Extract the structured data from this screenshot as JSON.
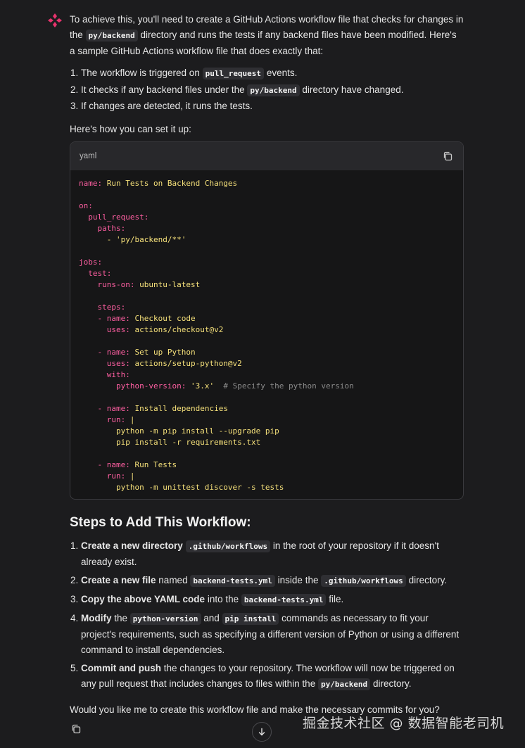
{
  "message": {
    "intro_1": "To achieve this, you'll need to create a GitHub Actions workflow file that checks for changes in the ",
    "intro_code": "py/backend",
    "intro_2": " directory and runs the tests if any backend files have been modified. Here's a sample GitHub Actions workflow file that does exactly that:",
    "list1": [
      {
        "pre": "The workflow is triggered on ",
        "code": "pull_request",
        "post": " events."
      },
      {
        "pre": "It checks if any backend files under the ",
        "code": "py/backend",
        "post": " directory have changed."
      },
      {
        "pre": "If changes are detected, it runs the tests.",
        "code": "",
        "post": ""
      }
    ],
    "setup_text": "Here's how you can set it up:",
    "code_block": {
      "language": "yaml",
      "copy_icon": "copy-icon"
    },
    "steps_heading": "Steps to Add This Workflow:",
    "steps": {
      "s1_bold": "Create a new directory",
      "s1_code": ".github/workflows",
      "s1_rest": " in the root of your repository if it doesn't already exist.",
      "s2_bold": "Create a new file",
      "s2_a": " named ",
      "s2_code1": "backend-tests.yml",
      "s2_b": " inside the ",
      "s2_code2": ".github/workflows",
      "s2_c": " directory.",
      "s3_bold": "Copy the above YAML code",
      "s3_a": " into the ",
      "s3_code": "backend-tests.yml",
      "s3_b": " file.",
      "s4_bold": "Modify",
      "s4_a": " the ",
      "s4_code1": "python-version",
      "s4_b": " and ",
      "s4_code2": "pip install",
      "s4_c": " commands as necessary to fit your project's requirements, such as specifying a different version of Python or using a different command to install dependencies.",
      "s5_bold": "Commit and push",
      "s5_a": " the changes to your repository. The workflow will now be triggered on any pull request that includes changes to files within the ",
      "s5_code": "py/backend",
      "s5_b": " directory."
    },
    "closing": "Would you like me to create this workflow file and make the necessary commits for you?"
  },
  "yaml": {
    "name_k": "name:",
    "name_v": " Run Tests on Backend Changes",
    "on_k": "on:",
    "pr_k": "  pull_request:",
    "paths_k": "    paths:",
    "path_v": "      - 'py/backend/**'",
    "jobs_k": "jobs:",
    "test_k": "  test:",
    "runs_k": "    runs-on:",
    "runs_v": " ubuntu-latest",
    "steps_k": "    steps:",
    "s1_dash": "    - ",
    "s1_name_k": "name:",
    "s1_name_v": " Checkout code",
    "s1_uses_k": "      uses:",
    "s1_uses_v": " actions/checkout@v2",
    "s2_dash": "    - ",
    "s2_name_k": "name:",
    "s2_name_v": " Set up Python",
    "s2_uses_k": "      uses:",
    "s2_uses_v": " actions/setup-python@v2",
    "s2_with_k": "      with:",
    "s2_pv_k": "        python-version:",
    "s2_pv_v": " '3.x'",
    "s2_comment": "  # Specify the python version",
    "s3_dash": "    - ",
    "s3_name_k": "name:",
    "s3_name_v": " Install dependencies",
    "s3_run_k": "      run:",
    "s3_run_v": " |",
    "s3_l1": "        python -m pip install --upgrade pip",
    "s3_l2": "        pip install -r requirements.txt",
    "s4_dash": "    - ",
    "s4_name_k": "name:",
    "s4_name_v": " Run Tests",
    "s4_run_k": "      run:",
    "s4_run_v": " |",
    "s4_l1": "        python -m unittest discover -s tests"
  },
  "footer": {
    "copy_icon": "copy-icon",
    "scroll_icon": "arrow-down-icon",
    "watermark": "掘金技术社区 @ 数据智能老司机"
  },
  "colors": {
    "background": "#1c1c1e",
    "yaml_key": "#ff5fa2",
    "yaml_value": "#f5e07a",
    "avatar": "#e8336d"
  }
}
